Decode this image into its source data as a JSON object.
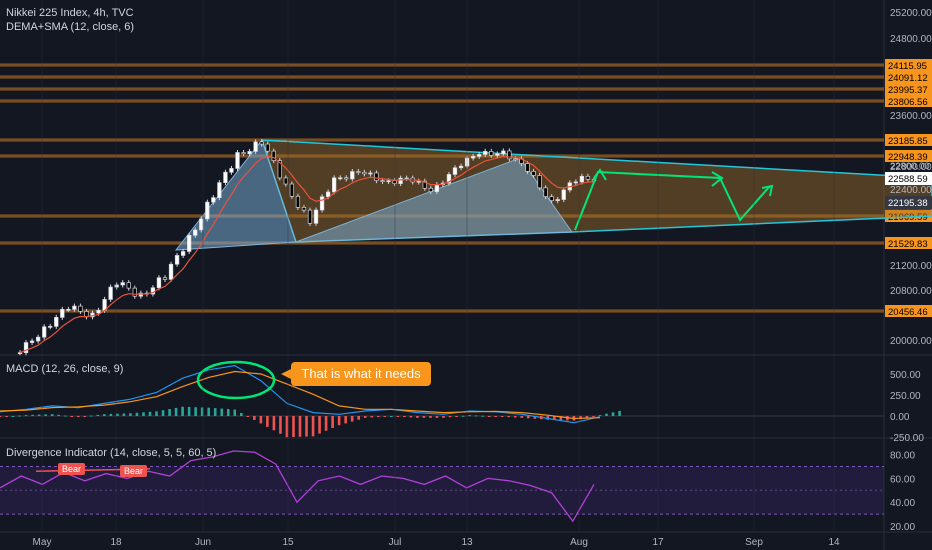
{
  "main_pane": {
    "title": "Nikkei 225 Index, 4h, TVC",
    "indicator": "DEMA+SMA (12, close, 6)",
    "axis_ticks": [
      "25200.00",
      "24800.00",
      "23600.00",
      "22800.00",
      "22400.00",
      "21200.00",
      "20800.00",
      "20000.00"
    ],
    "level_labels": [
      "24115.95",
      "24091.12",
      "23995.37",
      "23806.56",
      "23185.85",
      "22948.39",
      "21969.59",
      "21529.83",
      "20456.46"
    ],
    "current_price": "22588.59",
    "marker_price": "22195.38",
    "partial_label": "22800.00"
  },
  "macd_pane": {
    "title": "MACD (12, 26, close, 9)",
    "axis_ticks": [
      "500.00",
      "250.00",
      "0.00",
      "-250.00"
    ],
    "callout": "That is what it needs"
  },
  "div_pane": {
    "title": "Divergence Indicator (14, close, 5, 5, 60, 5)",
    "axis_ticks": [
      "80.00",
      "60.00",
      "40.00",
      "20.00"
    ],
    "bear_labels": [
      "Bear",
      "Bear"
    ]
  },
  "time_axis": [
    "May",
    "18",
    "Jun",
    "15",
    "Jul",
    "13",
    "Aug",
    "17",
    "Sep",
    "14"
  ],
  "colors": {
    "background": "#131722",
    "level_line": "#f7951d",
    "triangle_edge": "#26c6da",
    "arrow": "#00e676",
    "rsi_line": "#9c27b0",
    "macd_line": "#26a69a",
    "signal_line": "#f7951d",
    "bear_label": "#ef5350"
  },
  "chart_data": [
    {
      "type": "line",
      "title": "Nikkei 225 Index, 4h, TVC",
      "x": [
        "May",
        "18",
        "Jun",
        "15",
        "Jul",
        "13",
        "Aug",
        "17",
        "Sep",
        "14"
      ],
      "price_axis": [
        20000,
        20800,
        21200,
        22400,
        22800,
        23600,
        24800,
        25200
      ],
      "horizontal_levels": [
        24115.95,
        24091.12,
        23995.37,
        23806.56,
        23185.85,
        22948.39,
        21969.59,
        21529.83,
        20456.46
      ],
      "current_price": 22588.59,
      "approx_close_path": [
        19800,
        20200,
        20500,
        20400,
        20900,
        20700,
        21000,
        21600,
        22300,
        22900,
        23150,
        22400,
        21900,
        22500,
        22700,
        22450,
        22600,
        22300,
        22750,
        22900,
        23000,
        22650,
        22200,
        22500,
        22588
      ]
    },
    {
      "type": "line",
      "title": "MACD (12, 26, close, 9)",
      "ylim": [
        -250,
        500
      ],
      "series": [
        {
          "name": "MACD",
          "values": [
            50,
            80,
            120,
            100,
            150,
            200,
            280,
            450,
            550,
            600,
            420,
            150,
            40,
            20,
            60,
            80,
            40,
            20,
            60,
            50,
            20,
            -30,
            -80,
            -10
          ]
        },
        {
          "name": "Signal",
          "values": [
            60,
            70,
            100,
            110,
            130,
            170,
            230,
            350,
            460,
            530,
            500,
            380,
            260,
            120,
            80,
            80,
            60,
            40,
            50,
            55,
            40,
            10,
            -30,
            -20
          ]
        }
      ]
    },
    {
      "type": "line",
      "title": "Divergence Indicator (14, close, 5, 5, 60, 5)",
      "ylim": [
        20,
        85
      ],
      "values": [
        52,
        62,
        55,
        65,
        58,
        64,
        60,
        66,
        62,
        75,
        78,
        83,
        82,
        72,
        40,
        58,
        62,
        55,
        62,
        60,
        55,
        62,
        52,
        60,
        58,
        54,
        48,
        24,
        55
      ]
    }
  ]
}
